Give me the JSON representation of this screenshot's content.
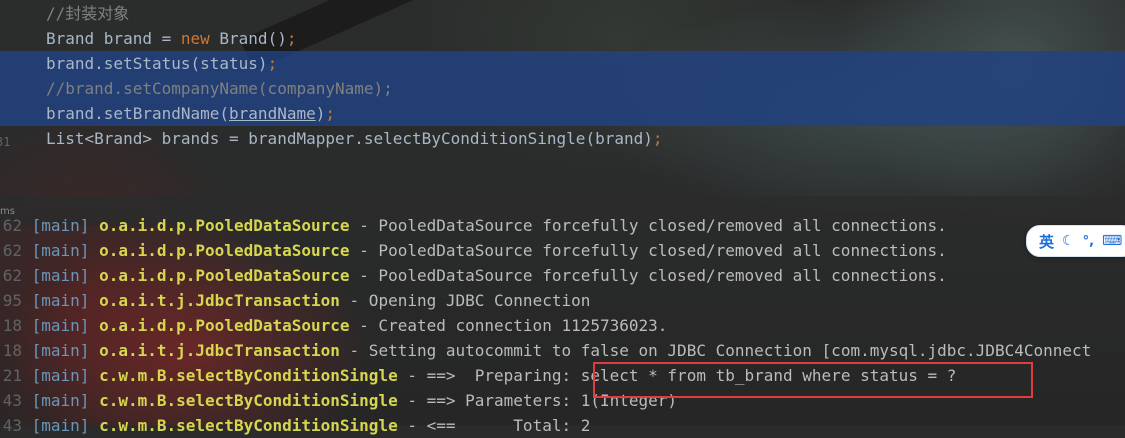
{
  "editor": {
    "lines": [
      {
        "text": "//封装对象"
      },
      {
        "parts": [
          {
            "text": "Brand brand = "
          },
          {
            "text": "new"
          },
          {
            "text": " Brand()"
          },
          {
            "text": ";"
          }
        ]
      },
      {
        "parts": [
          {
            "text": "brand.setStatus(status)"
          },
          {
            "text": ";"
          }
        ]
      },
      {
        "text": "//brand.setCompanyName(companyName);"
      },
      {
        "parts": [
          {
            "text": "brand.setBrandName("
          },
          {
            "text": "brandName"
          },
          {
            "text": ")"
          },
          {
            "text": ";"
          }
        ]
      },
      {
        "parts": [
          {
            "text": "List<Brand> brands = brandMapper.selectByConditionSingle(brand)"
          },
          {
            "text": ";"
          }
        ]
      }
    ],
    "gutter_partial": "31"
  },
  "console": {
    "ms_label": "ms",
    "lines": [
      {
        "ln": "62",
        "thread": "[main]",
        "logger": "o.a.i.d.p.PooledDataSource",
        "msg": " - PooledDataSource forcefully closed/removed all connections."
      },
      {
        "ln": "62",
        "thread": "[main]",
        "logger": "o.a.i.d.p.PooledDataSource",
        "msg": " - PooledDataSource forcefully closed/removed all connections."
      },
      {
        "ln": "62",
        "thread": "[main]",
        "logger": "o.a.i.d.p.PooledDataSource",
        "msg": " - PooledDataSource forcefully closed/removed all connections."
      },
      {
        "ln": "95",
        "thread": "[main]",
        "logger": "o.a.i.t.j.JdbcTransaction",
        "msg": " - Opening JDBC Connection"
      },
      {
        "ln": "18",
        "thread": "[main]",
        "logger": "o.a.i.d.p.PooledDataSource",
        "msg": " - Created connection 1125736023."
      },
      {
        "ln": "18",
        "thread": "[main]",
        "logger": "o.a.i.t.j.JdbcTransaction",
        "msg": " - Setting autocommit to false on JDBC Connection [com.mysql.jdbc.JDBC4Connect"
      },
      {
        "ln": "21",
        "thread": "[main]",
        "logger": "c.w.m.B.selectByConditionSingle",
        "msg": " - ==>  Preparing: select * from tb_brand where status = ?"
      },
      {
        "ln": "43",
        "thread": "[main]",
        "logger": "c.w.m.B.selectByConditionSingle",
        "msg": " - ==> Parameters: 1(Integer)"
      },
      {
        "ln": "43",
        "thread": "[main]",
        "logger": "c.w.m.B.selectByConditionSingle",
        "msg": " - <==      Total: 2"
      }
    ]
  },
  "ime": {
    "lang": "英",
    "moon_icon": "moon-icon",
    "punct": "°,",
    "keyboard_icon": "keyboard-icon"
  },
  "colors": {
    "selection": "#214283",
    "keyword": "#cc7832",
    "comment": "#808080",
    "logger": "#d6d64f",
    "thread": "#6897bb",
    "highlight_border": "#e03e3e"
  }
}
